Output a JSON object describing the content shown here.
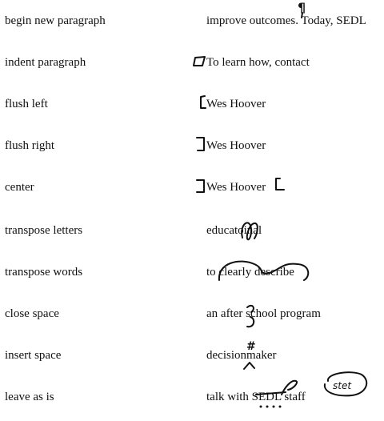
{
  "rows": [
    {
      "label": "begin new paragraph",
      "example": "improve outcomes. Today, SEDL",
      "mark": "pilcrow-mark"
    },
    {
      "label": "indent paragraph",
      "example": "To learn how, contact",
      "mark": "indent-box-mark"
    },
    {
      "label": "flush left",
      "example": "Wes Hoover",
      "mark": "flush-left-bracket-mark"
    },
    {
      "label": "flush right",
      "example": "Wes Hoover",
      "mark": "flush-right-bracket-mark"
    },
    {
      "label": "center",
      "example": "Wes Hoover",
      "mark": "center-brackets-mark"
    },
    {
      "label": "transpose letters",
      "example": "educatoinal",
      "mark": "transpose-letters-mark"
    },
    {
      "label": "transpose words",
      "example": "to clearly describe",
      "mark": "transpose-words-mark"
    },
    {
      "label": "close space",
      "example": "an after school program",
      "mark": "close-space-mark"
    },
    {
      "label": "insert space",
      "example": "decisionmaker",
      "mark": "insert-space-mark"
    },
    {
      "label": "leave as is",
      "example": "talk with SEDL staff",
      "mark": "stet-mark"
    }
  ],
  "annotations": {
    "paragraph_symbol": "¶",
    "space_symbol": "#",
    "stet": "stet"
  }
}
